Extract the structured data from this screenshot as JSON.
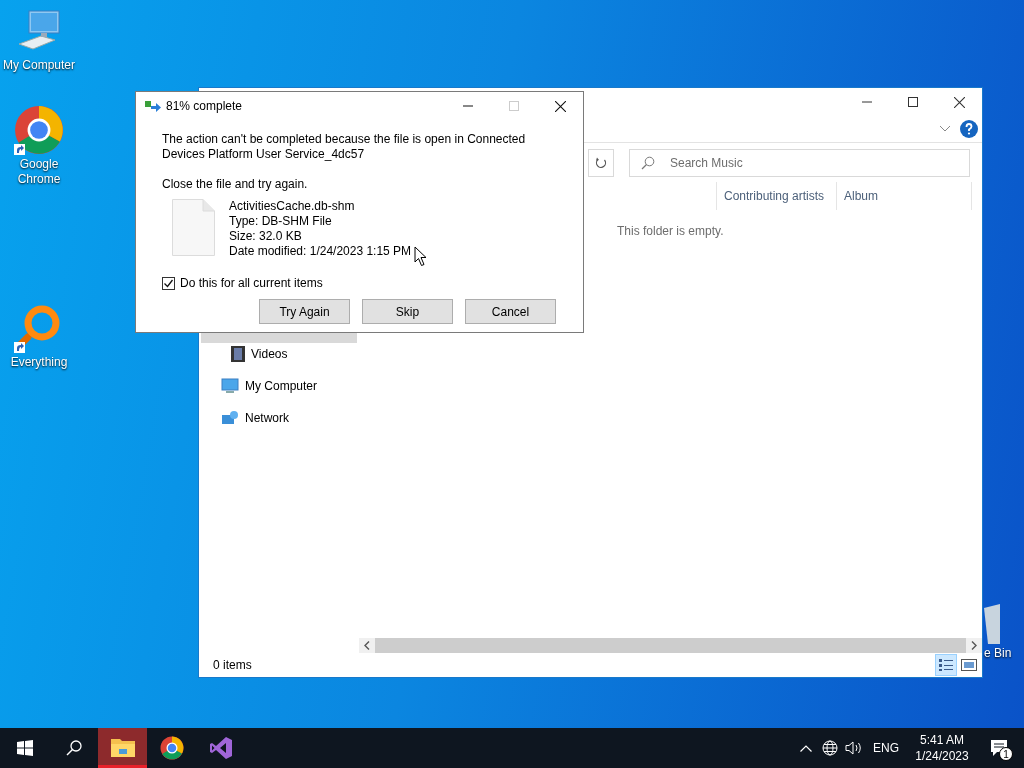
{
  "desktop_icons": [
    {
      "kind": "computer",
      "label": "My Computer"
    },
    {
      "kind": "chrome",
      "label": "Google Chrome"
    },
    {
      "kind": "everything",
      "label": "Everything"
    },
    {
      "kind": "recycle",
      "label": "e Bin"
    }
  ],
  "explorer": {
    "search_placeholder": "Search Music",
    "columns": [
      "Contributing artists",
      "Album"
    ],
    "empty_text": "This folder is empty.",
    "nav_items": [
      {
        "kind": "videos",
        "label": "Videos"
      },
      {
        "kind": "computer",
        "label": "My Computer"
      },
      {
        "kind": "network",
        "label": "Network"
      }
    ],
    "status": "0 items",
    "view_buttons": [
      {
        "kind": "details",
        "selected": true
      },
      {
        "kind": "tiles",
        "selected": false
      }
    ]
  },
  "dialog": {
    "title": "81% complete",
    "controls": [
      {
        "kind": "minimize",
        "disabled": false
      },
      {
        "kind": "maximize",
        "disabled": true
      },
      {
        "kind": "close",
        "disabled": false
      }
    ],
    "message": "The action can't be completed because the file is open in Connected Devices Platform User Service_4dc57",
    "instruction": "Close the file and try again.",
    "file_lines": [
      "ActivitiesCache.db-shm",
      "Type: DB-SHM File",
      "Size: 32.0 KB",
      "Date modified: 1/24/2023 1:15 PM"
    ],
    "checkbox": {
      "label": "Do this for all current items",
      "checked": true
    },
    "buttons": [
      "Try Again",
      "Skip",
      "Cancel"
    ]
  },
  "taskbar": {
    "items": [
      {
        "kind": "start",
        "active": false
      },
      {
        "kind": "search",
        "active": false
      },
      {
        "kind": "explorer",
        "active": true
      },
      {
        "kind": "chrome",
        "active": false
      },
      {
        "kind": "vs",
        "active": false
      }
    ],
    "language": "ENG",
    "time": "5:41 AM",
    "date": "1/24/2023",
    "notification_count": "1"
  }
}
